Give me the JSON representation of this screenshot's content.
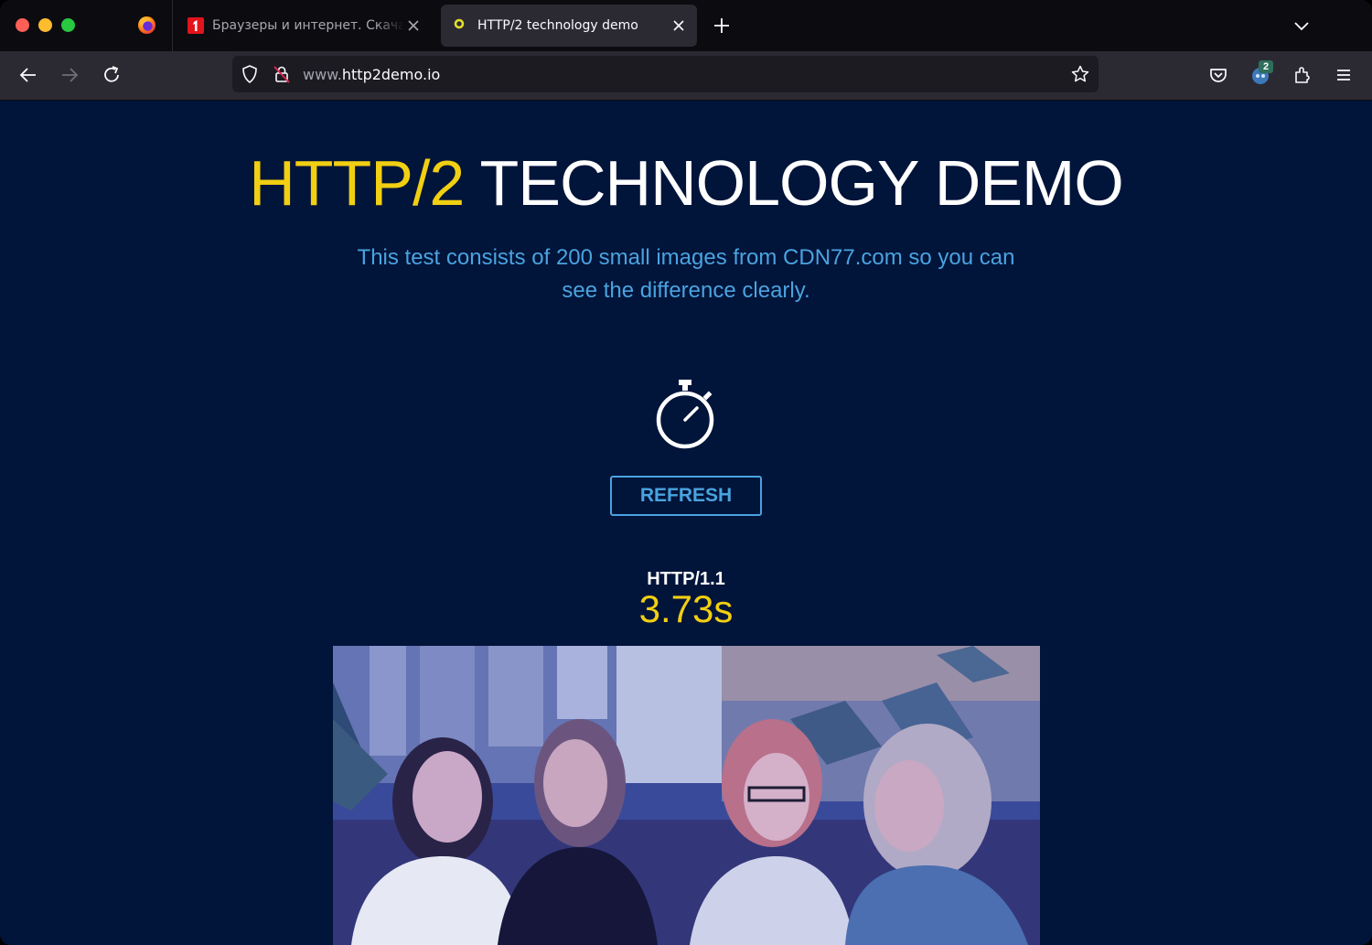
{
  "browser": {
    "tabs": [
      {
        "title": "Браузеры и интернет. Скачать",
        "active": false,
        "favicon": "red-number-one-favicon"
      },
      {
        "title": "HTTP/2 technology demo",
        "active": true,
        "favicon": "yellow-ring-favicon"
      }
    ],
    "url": {
      "prefix": "www.",
      "domain": "http2demo.io"
    },
    "account_badge": "2"
  },
  "page": {
    "title_accent": "HTTP/2",
    "title_rest": " TECHNOLOGY DEMO",
    "subtitle": "This test consists of 200 small images from CDN77.com so you can see the difference clearly.",
    "refresh_label": "REFRESH",
    "protocol": "HTTP/1.1",
    "load_time": "3.73s"
  },
  "colors": {
    "page_background": "#01143a",
    "accent_yellow": "#f1cf12",
    "accent_blue": "#4aa3df"
  }
}
